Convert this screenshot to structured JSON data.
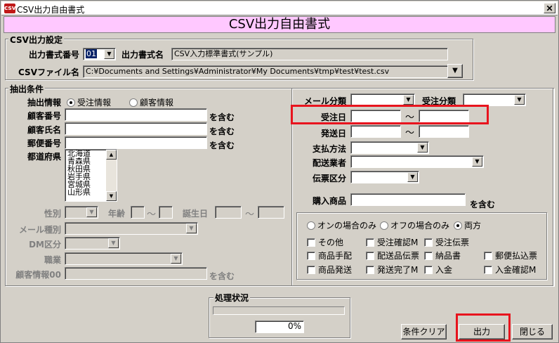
{
  "window": {
    "title": "CSV出力自由書式",
    "app_icon": "csv-app-icon"
  },
  "banner": {
    "title": "CSV出力自由書式"
  },
  "csv_settings": {
    "legend": "CSV出力設定",
    "format_no_label": "出力書式番号",
    "format_no_value": "01",
    "format_name_label": "出力書式名",
    "format_name_value": "CSV入力標準書式(サンプル)",
    "csv_file_label": "CSVファイル名",
    "csv_file_value": "C:¥Documents and Settings¥Administrator¥My Documents¥tmp¥test¥test.csv"
  },
  "conditions": {
    "legend": "抽出条件",
    "info_label": "抽出情報",
    "radio_order": "受注情報",
    "radio_customer": "顧客情報",
    "customer_no_label": "顧客番号",
    "customer_name_label": "顧客氏名",
    "postal_label": "郵便番号",
    "prefecture_label": "都道府県",
    "contains": "を含む",
    "prefectures": [
      "北海道",
      "青森県",
      "秋田県",
      "岩手県",
      "宮城県",
      "山形県"
    ],
    "gender_label": "性別",
    "age_label": "年齢",
    "birthday_label": "誕生日",
    "tilde": "〜",
    "mail_type_label": "メール種別",
    "dm_label": "DM区分",
    "job_label": "職業",
    "customer_info_label": "顧客情報00"
  },
  "right": {
    "mail_class_label": "メール分類",
    "order_class_label": "受注分類",
    "order_date_label": "受注日",
    "ship_date_label": "発送日",
    "payment_label": "支払方法",
    "carrier_label": "配送業者",
    "slip_label": "伝票区分",
    "product_label": "購入商品",
    "contains": "を含む",
    "tilde": "〜",
    "mode_on": "オンの場合のみ",
    "mode_off": "オフの場合のみ",
    "mode_both": "両方",
    "flags": [
      "その他",
      "受注確認M",
      "受注伝票",
      "商品手配",
      "配送品伝票",
      "納品書",
      "郵便払込票",
      "商品発送",
      "発送完了M",
      "入金",
      "入金確認M"
    ]
  },
  "status": {
    "legend": "処理状況",
    "percent": "0%",
    "progress": 0
  },
  "buttons": {
    "clear": "条件クリア",
    "output": "出力",
    "close": "閉じる"
  },
  "highlight_color": "#e8141e",
  "banner_color": "#ffc8ff"
}
